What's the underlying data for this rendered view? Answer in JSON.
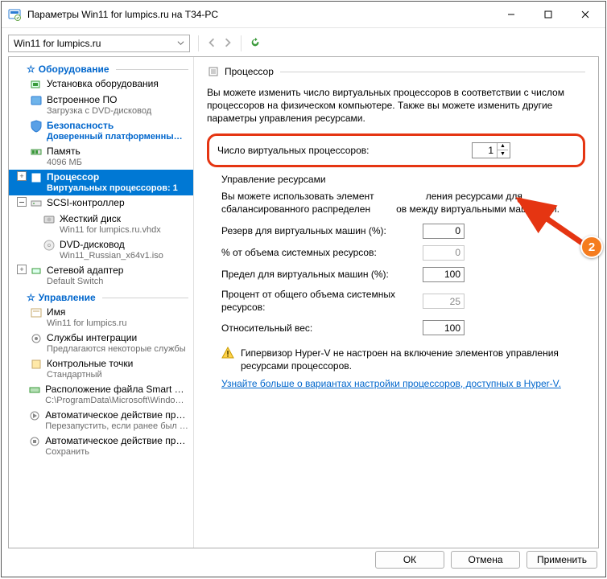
{
  "window": {
    "title": "Параметры Win11 for lumpics.ru на T34-PC"
  },
  "toolbar": {
    "vm_name": "Win11 for lumpics.ru"
  },
  "tree": {
    "hw_header": "Оборудование",
    "mgmt_header": "Управление",
    "items": [
      {
        "k": "add_hw",
        "label": "Установка оборудования",
        "sub": ""
      },
      {
        "k": "firmware",
        "label": "Встроенное ПО",
        "sub": "Загрузка с DVD-дисковод"
      },
      {
        "k": "security",
        "label": "Безопасность",
        "sub": "Доверенный платформенны…",
        "bold": true
      },
      {
        "k": "memory",
        "label": "Память",
        "sub": "4096 МБ"
      },
      {
        "k": "cpu",
        "label": "Процессор",
        "sub": "Виртуальных процессоров: 1",
        "selected": true
      },
      {
        "k": "scsi",
        "label": "SCSI-контроллер",
        "sub": ""
      },
      {
        "k": "hdd",
        "label": "Жесткий диск",
        "sub": "Win11 for lumpics.ru.vhdx"
      },
      {
        "k": "dvd",
        "label": "DVD-дисковод",
        "sub": "Win11_Russian_x64v1.iso"
      },
      {
        "k": "net",
        "label": "Сетевой адаптер",
        "sub": "Default Switch"
      }
    ],
    "mgmt_items": [
      {
        "k": "name",
        "label": "Имя",
        "sub": "Win11 for lumpics.ru"
      },
      {
        "k": "integ",
        "label": "Службы интеграции",
        "sub": "Предлагаются некоторые службы"
      },
      {
        "k": "chk",
        "label": "Контрольные точки",
        "sub": "Стандартный"
      },
      {
        "k": "smart",
        "label": "Расположение файла Smart Paging",
        "sub": "C:\\ProgramData\\Microsoft\\Windo…"
      },
      {
        "k": "auto_start",
        "label": "Автоматическое действие при за…",
        "sub": "Перезапустить, если ранее был …"
      },
      {
        "k": "auto_stop",
        "label": "Автоматическое действие при за…",
        "sub": "Сохранить"
      }
    ]
  },
  "right": {
    "group": "Процессор",
    "desc": "Вы можете изменить число виртуальных процессоров в соответствии с числом процессоров на физическом компьютере. Также вы можете изменить другие параметры управления ресурсами.",
    "vcpu_label": "Число виртуальных процессоров:",
    "vcpu_value": "1",
    "res_header": "Управление ресурсами",
    "res_desc_1": "Вы можете использовать элемент",
    "res_desc_2": "ления ресурсами для сбалансированного распределен",
    "res_desc_3": "ов между виртуальными машинами.",
    "rows": {
      "reserve_label": "Резерв для виртуальных машин (%):",
      "reserve_val": "0",
      "pct_label": "% от объема системных ресурсов:",
      "pct_val": "0",
      "limit_label": "Предел для виртуальных машин (%):",
      "limit_val": "100",
      "pct2_label": "Процент от общего объема системных ресурсов:",
      "pct2_val": "25",
      "weight_label": "Относительный вес:",
      "weight_val": "100"
    },
    "warn": "Гипервизор Hyper-V не настроен на включение элементов управления ресурсами процессоров.",
    "link": "Узнайте больше о вариантах настройки процессоров, доступных в Hyper-V."
  },
  "buttons": {
    "ok": "ОК",
    "cancel": "Отмена",
    "apply": "Применить"
  },
  "badge": "2"
}
